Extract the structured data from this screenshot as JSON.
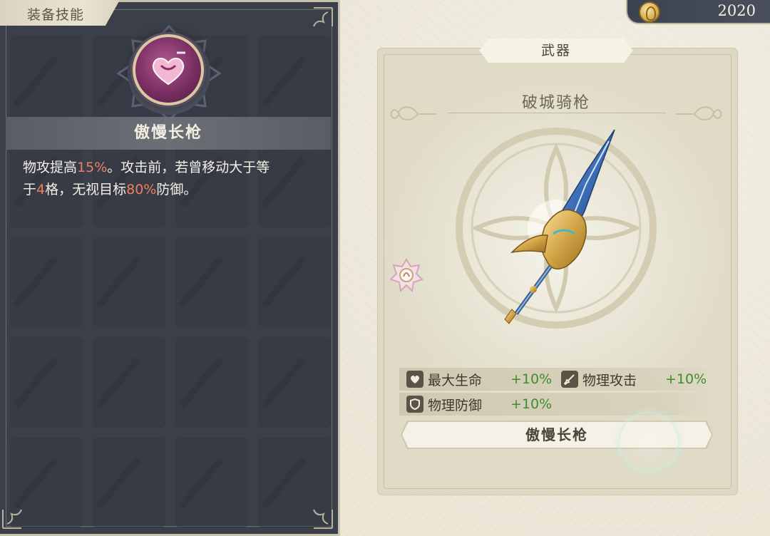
{
  "left_panel": {
    "tab_label": "装备技能",
    "skill_name": "傲慢长枪",
    "description": {
      "line1_a": "物攻提高",
      "line1_hl": "15%",
      "line1_b": "。攻击前，若曾移动大于等",
      "line2_a": "于",
      "line2_hl1": "4",
      "line2_b": "格，无视目标",
      "line2_hl2": "80%",
      "line2_c": "防御。"
    },
    "icon": "heart-lance-icon"
  },
  "currency": {
    "icon": "gold-coin-icon",
    "value": "2020"
  },
  "weapon_card": {
    "category": "武器",
    "name": "破城骑枪",
    "stats": [
      {
        "icon": "heart-icon",
        "label": "最大生命",
        "value": "+10%"
      },
      {
        "icon": "sword-icon",
        "label": "物理攻击",
        "value": "+10%"
      },
      {
        "icon": "shield-icon",
        "label": "物理防御",
        "value": "+10%"
      }
    ],
    "skill_button": "傲慢长枪"
  },
  "colors": {
    "highlight": "#ef7f5e",
    "stat_value": "#3e8e2c",
    "panel_dark": "#3b3f4a",
    "parchment": "#ebe6d6"
  }
}
